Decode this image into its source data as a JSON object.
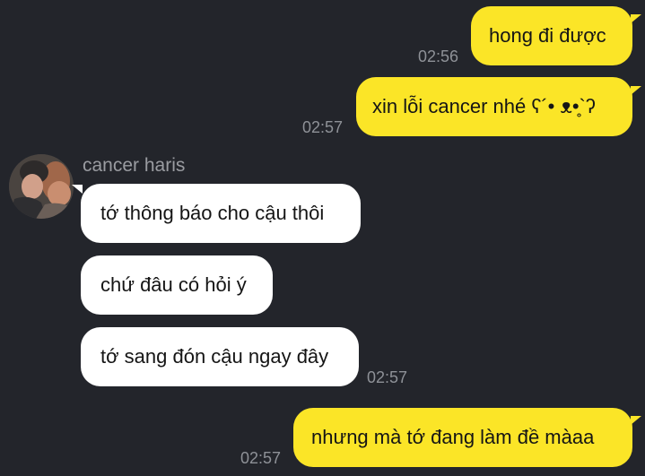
{
  "contact": {
    "name": "cancer haris",
    "avatar_icon": "profile-photo"
  },
  "colors": {
    "background": "#23252b",
    "outgoing_bubble": "#fbe527",
    "incoming_bubble": "#ffffff",
    "timestamp": "#8e9197",
    "sender_name": "#9a9ca1"
  },
  "messages": [
    {
      "direction": "outgoing",
      "text": "hong đi được",
      "time": "02:56"
    },
    {
      "direction": "outgoing",
      "text": "xin lỗi cancer nhé ʕ´• ᴥ•̥`ʔ",
      "time": "02:57"
    },
    {
      "direction": "incoming",
      "text": "tớ thông báo cho cậu thôi",
      "time": ""
    },
    {
      "direction": "incoming",
      "text": "chứ đâu có hỏi ý",
      "time": ""
    },
    {
      "direction": "incoming",
      "text": "tớ sang đón cậu ngay đây",
      "time": "02:57"
    },
    {
      "direction": "outgoing",
      "text": "nhưng mà tớ đang làm đề màaa",
      "time": "02:57"
    }
  ]
}
